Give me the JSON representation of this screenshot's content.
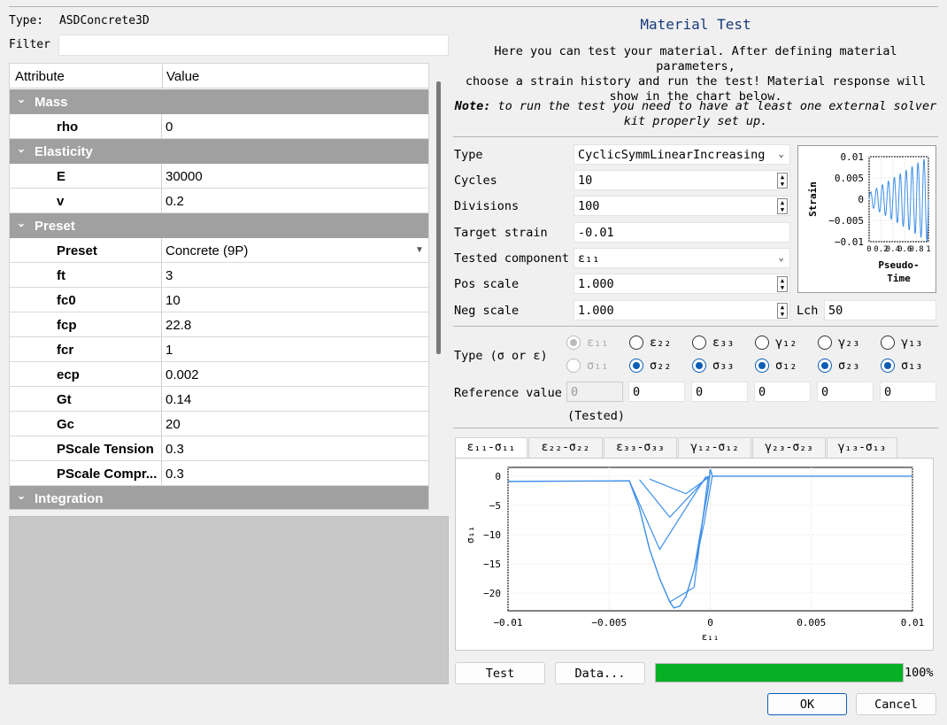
{
  "left": {
    "type_label": "Type:",
    "type_value": "ASDConcrete3D",
    "filter_label": "Filter",
    "filter_value": "",
    "tree": {
      "col_attribute": "Attribute",
      "col_value": "Value",
      "groups": {
        "mass": "Mass",
        "elasticity": "Elasticity",
        "preset": "Preset",
        "integration": "Integration"
      },
      "rows": [
        {
          "key": "rho",
          "value": "0"
        },
        {
          "key": "E",
          "value": "30000"
        },
        {
          "key": "v",
          "value": "0.2"
        },
        {
          "key": "Preset",
          "value": "Concrete (9P)"
        },
        {
          "key": "ft",
          "value": "3"
        },
        {
          "key": "fc0",
          "value": "10"
        },
        {
          "key": "fcp",
          "value": "22.8"
        },
        {
          "key": "fcr",
          "value": "1"
        },
        {
          "key": "ecp",
          "value": "0.002"
        },
        {
          "key": "Gt",
          "value": "0.14"
        },
        {
          "key": "Gc",
          "value": "20"
        },
        {
          "key": "PScale Tension",
          "value": "0.3"
        },
        {
          "key": "PScale Compr...",
          "value": "0.3"
        }
      ]
    }
  },
  "right": {
    "title": "Material Test",
    "description_1": "Here you can test your material. After defining material parameters,",
    "description_2": "choose a strain history and run the test! Material response will",
    "description_3": "show in the chart below.",
    "note_bold": "Note:",
    "note_text_1": " to run the test you need to have at least one external solver",
    "note_text_2": "kit properly set up.",
    "form": {
      "type_label": "Type",
      "type_value": "CyclicSymmLinearIncreasing",
      "cycles_label": "Cycles",
      "cycles_value": "10",
      "divisions_label": "Divisions",
      "divisions_value": "100",
      "target_label": "Target strain",
      "target_value": "-0.01",
      "component_label": "Tested component",
      "component_value": "ε₁₁",
      "pos_label": "Pos scale",
      "pos_value": "1.000",
      "neg_label": "Neg scale",
      "neg_value": "1.000",
      "lch_label": "Lch",
      "lch_value": "50"
    },
    "type_sigma_eps_label": "Type (σ or ε)",
    "strain_radios": [
      "ε₁₁",
      "ε₂₂",
      "ε₃₃",
      "γ₁₂",
      "γ₂₃",
      "γ₁₃"
    ],
    "stress_radios": [
      "σ₁₁",
      "σ₂₂",
      "σ₃₃",
      "σ₁₂",
      "σ₂₃",
      "σ₁₃"
    ],
    "radio_state": {
      "stress_selected": [
        false,
        true,
        true,
        true,
        true,
        true
      ],
      "strain_selected": [
        true,
        false,
        false,
        false,
        false,
        false
      ]
    },
    "reference_label": "Reference value",
    "reference_values": [
      "0",
      "0",
      "0",
      "0",
      "0",
      "0"
    ],
    "tested_label": "(Tested)",
    "tabs": [
      "ε₁₁-σ₁₁",
      "ε₂₂-σ₂₂",
      "ε₃₃-σ₃₃",
      "γ₁₂-σ₁₂",
      "γ₂₃-σ₂₃",
      "γ₁₃-σ₁₃"
    ],
    "active_tab": 0,
    "buttons": {
      "test": "Test",
      "data": "Data...",
      "ok": "OK",
      "cancel": "Cancel"
    },
    "progress_value": 100,
    "progress_label": "100%"
  },
  "chart_data": [
    {
      "type": "line",
      "title": "",
      "xlabel": "Pseudo-Time",
      "ylabel": "Strain",
      "xlim": [
        0,
        1
      ],
      "ylim": [
        -0.01,
        0.01
      ],
      "x_ticks": [
        "0",
        "0.2",
        "0.4",
        "0.6",
        "0.8",
        "1"
      ],
      "y_ticks": [
        "0.01",
        "0.005",
        "0",
        "−0.005",
        "−0.01"
      ],
      "grid": true,
      "series": [
        {
          "color": "#3c8ee8",
          "cycles": 10,
          "divisions": 100,
          "target": -0.01,
          "description": "cyclic symmetric linearly increasing amplitude"
        }
      ]
    },
    {
      "type": "line",
      "title": "",
      "xlabel": "ε₁₁",
      "ylabel": "σ₁₁",
      "xlim": [
        -0.01,
        0.01
      ],
      "ylim": [
        -23,
        1.5
      ],
      "x_ticks": [
        "−0.01",
        "−0.005",
        "0",
        "0.005",
        "0.01"
      ],
      "y_ticks": [
        "0",
        "−5",
        "−10",
        "−15",
        "−20"
      ],
      "grid": true,
      "series": [
        {
          "color": "#3c8ee8",
          "x": [
            -0.01,
            -0.004,
            -0.0035,
            -0.003,
            -0.0025,
            -0.002,
            -0.0018,
            -0.0015,
            -0.0012,
            -0.0008,
            -0.0004,
            -0.0001,
            0.0,
            0.0001,
            0.0003,
            0.01
          ],
          "y": [
            -0.9,
            -0.8,
            -5.5,
            -12.5,
            -17.5,
            -21.5,
            -22.5,
            -22.2,
            -20.5,
            -16,
            -8,
            -2,
            1.2,
            0,
            0,
            0
          ]
        }
      ]
    }
  ]
}
